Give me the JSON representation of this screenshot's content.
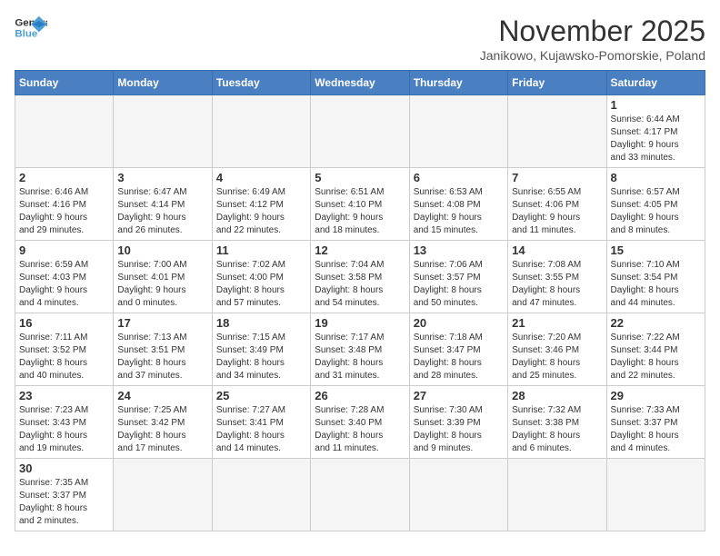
{
  "header": {
    "logo_general": "General",
    "logo_blue": "Blue",
    "month": "November 2025",
    "location": "Janikowo, Kujawsko-Pomorskie, Poland"
  },
  "days_of_week": [
    "Sunday",
    "Monday",
    "Tuesday",
    "Wednesday",
    "Thursday",
    "Friday",
    "Saturday"
  ],
  "weeks": [
    [
      {
        "day": "",
        "info": ""
      },
      {
        "day": "",
        "info": ""
      },
      {
        "day": "",
        "info": ""
      },
      {
        "day": "",
        "info": ""
      },
      {
        "day": "",
        "info": ""
      },
      {
        "day": "",
        "info": ""
      },
      {
        "day": "1",
        "info": "Sunrise: 6:44 AM\nSunset: 4:17 PM\nDaylight: 9 hours\nand 33 minutes."
      }
    ],
    [
      {
        "day": "2",
        "info": "Sunrise: 6:46 AM\nSunset: 4:16 PM\nDaylight: 9 hours\nand 29 minutes."
      },
      {
        "day": "3",
        "info": "Sunrise: 6:47 AM\nSunset: 4:14 PM\nDaylight: 9 hours\nand 26 minutes."
      },
      {
        "day": "4",
        "info": "Sunrise: 6:49 AM\nSunset: 4:12 PM\nDaylight: 9 hours\nand 22 minutes."
      },
      {
        "day": "5",
        "info": "Sunrise: 6:51 AM\nSunset: 4:10 PM\nDaylight: 9 hours\nand 18 minutes."
      },
      {
        "day": "6",
        "info": "Sunrise: 6:53 AM\nSunset: 4:08 PM\nDaylight: 9 hours\nand 15 minutes."
      },
      {
        "day": "7",
        "info": "Sunrise: 6:55 AM\nSunset: 4:06 PM\nDaylight: 9 hours\nand 11 minutes."
      },
      {
        "day": "8",
        "info": "Sunrise: 6:57 AM\nSunset: 4:05 PM\nDaylight: 9 hours\nand 8 minutes."
      }
    ],
    [
      {
        "day": "9",
        "info": "Sunrise: 6:59 AM\nSunset: 4:03 PM\nDaylight: 9 hours\nand 4 minutes."
      },
      {
        "day": "10",
        "info": "Sunrise: 7:00 AM\nSunset: 4:01 PM\nDaylight: 9 hours\nand 0 minutes."
      },
      {
        "day": "11",
        "info": "Sunrise: 7:02 AM\nSunset: 4:00 PM\nDaylight: 8 hours\nand 57 minutes."
      },
      {
        "day": "12",
        "info": "Sunrise: 7:04 AM\nSunset: 3:58 PM\nDaylight: 8 hours\nand 54 minutes."
      },
      {
        "day": "13",
        "info": "Sunrise: 7:06 AM\nSunset: 3:57 PM\nDaylight: 8 hours\nand 50 minutes."
      },
      {
        "day": "14",
        "info": "Sunrise: 7:08 AM\nSunset: 3:55 PM\nDaylight: 8 hours\nand 47 minutes."
      },
      {
        "day": "15",
        "info": "Sunrise: 7:10 AM\nSunset: 3:54 PM\nDaylight: 8 hours\nand 44 minutes."
      }
    ],
    [
      {
        "day": "16",
        "info": "Sunrise: 7:11 AM\nSunset: 3:52 PM\nDaylight: 8 hours\nand 40 minutes."
      },
      {
        "day": "17",
        "info": "Sunrise: 7:13 AM\nSunset: 3:51 PM\nDaylight: 8 hours\nand 37 minutes."
      },
      {
        "day": "18",
        "info": "Sunrise: 7:15 AM\nSunset: 3:49 PM\nDaylight: 8 hours\nand 34 minutes."
      },
      {
        "day": "19",
        "info": "Sunrise: 7:17 AM\nSunset: 3:48 PM\nDaylight: 8 hours\nand 31 minutes."
      },
      {
        "day": "20",
        "info": "Sunrise: 7:18 AM\nSunset: 3:47 PM\nDaylight: 8 hours\nand 28 minutes."
      },
      {
        "day": "21",
        "info": "Sunrise: 7:20 AM\nSunset: 3:46 PM\nDaylight: 8 hours\nand 25 minutes."
      },
      {
        "day": "22",
        "info": "Sunrise: 7:22 AM\nSunset: 3:44 PM\nDaylight: 8 hours\nand 22 minutes."
      }
    ],
    [
      {
        "day": "23",
        "info": "Sunrise: 7:23 AM\nSunset: 3:43 PM\nDaylight: 8 hours\nand 19 minutes."
      },
      {
        "day": "24",
        "info": "Sunrise: 7:25 AM\nSunset: 3:42 PM\nDaylight: 8 hours\nand 17 minutes."
      },
      {
        "day": "25",
        "info": "Sunrise: 7:27 AM\nSunset: 3:41 PM\nDaylight: 8 hours\nand 14 minutes."
      },
      {
        "day": "26",
        "info": "Sunrise: 7:28 AM\nSunset: 3:40 PM\nDaylight: 8 hours\nand 11 minutes."
      },
      {
        "day": "27",
        "info": "Sunrise: 7:30 AM\nSunset: 3:39 PM\nDaylight: 8 hours\nand 9 minutes."
      },
      {
        "day": "28",
        "info": "Sunrise: 7:32 AM\nSunset: 3:38 PM\nDaylight: 8 hours\nand 6 minutes."
      },
      {
        "day": "29",
        "info": "Sunrise: 7:33 AM\nSunset: 3:37 PM\nDaylight: 8 hours\nand 4 minutes."
      }
    ],
    [
      {
        "day": "30",
        "info": "Sunrise: 7:35 AM\nSunset: 3:37 PM\nDaylight: 8 hours\nand 2 minutes."
      },
      {
        "day": "",
        "info": ""
      },
      {
        "day": "",
        "info": ""
      },
      {
        "day": "",
        "info": ""
      },
      {
        "day": "",
        "info": ""
      },
      {
        "day": "",
        "info": ""
      },
      {
        "day": "",
        "info": ""
      }
    ]
  ]
}
